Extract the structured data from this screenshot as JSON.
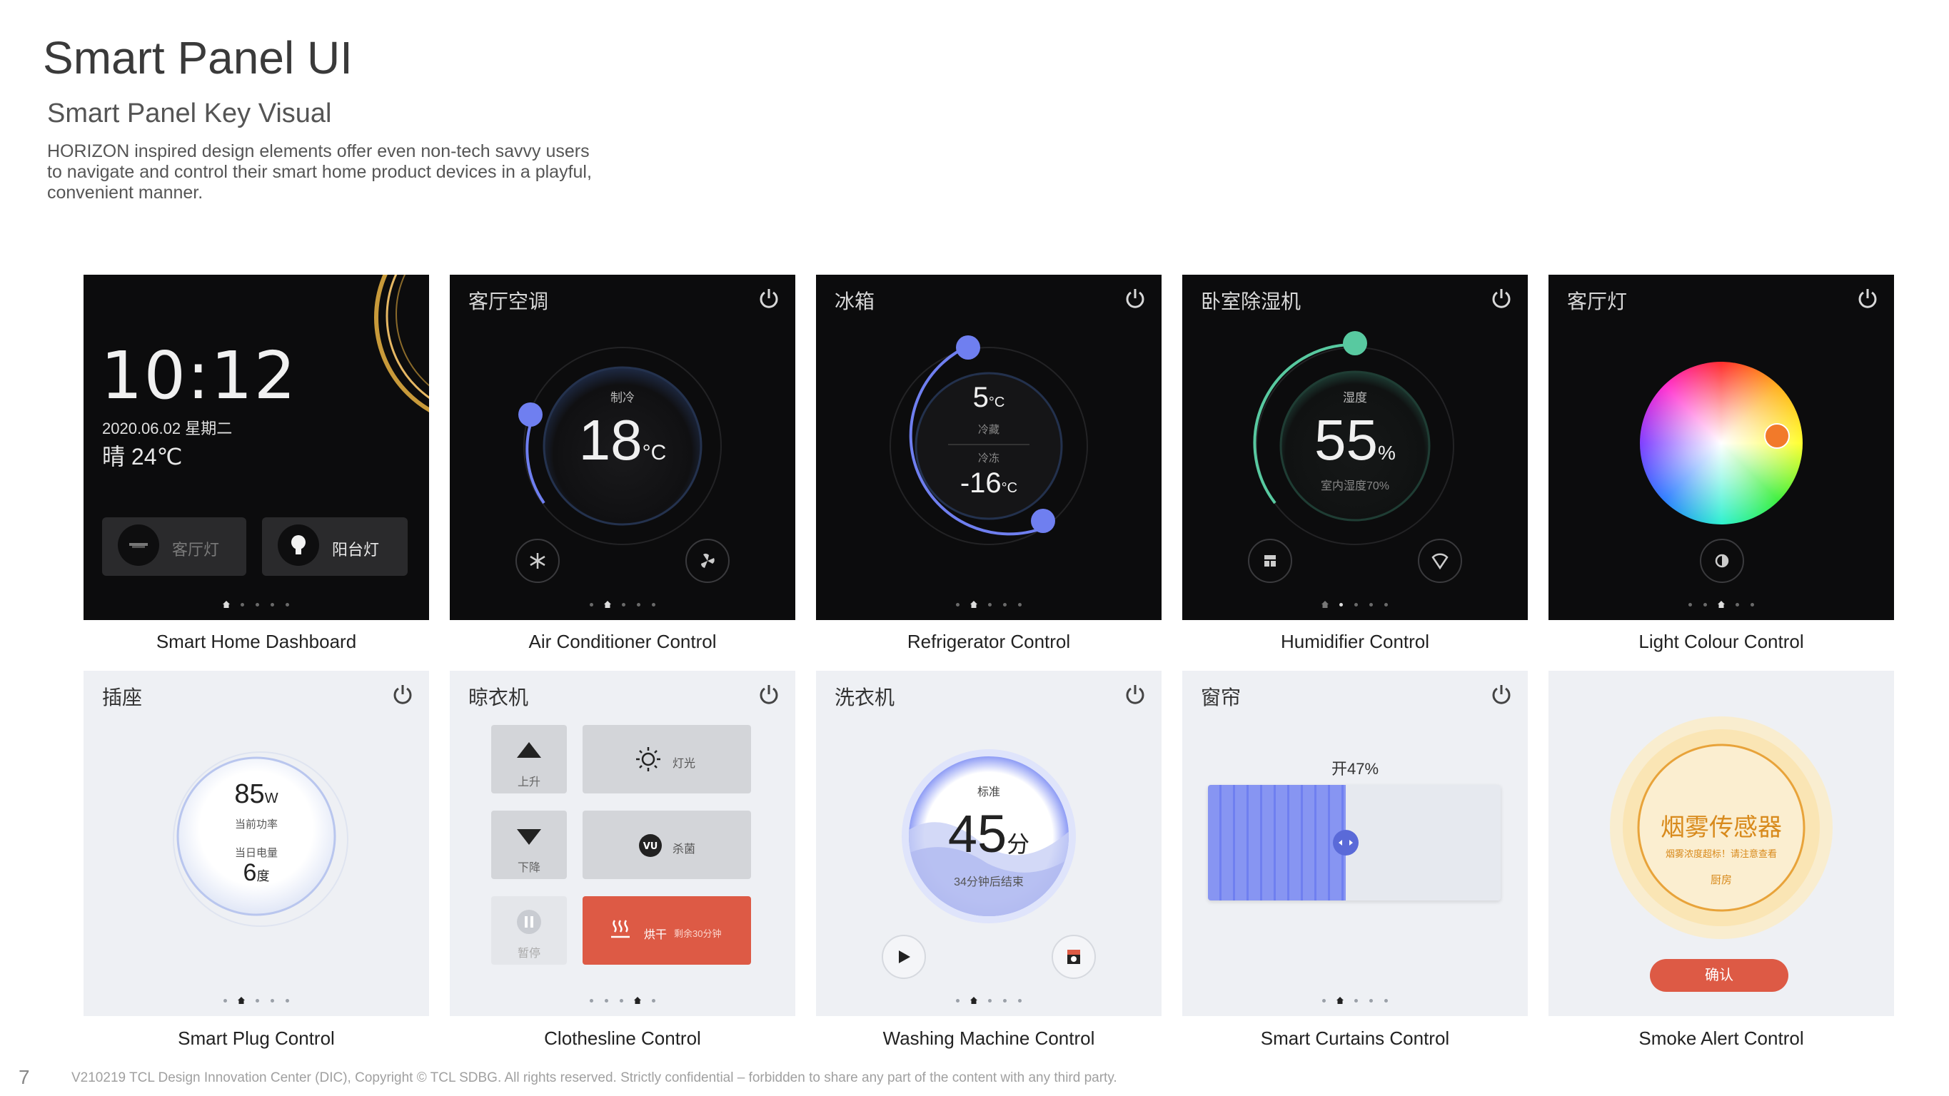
{
  "page": {
    "title": "Smart Panel UI",
    "subtitle": "Smart Panel Key Visual",
    "description": "HORIZON inspired design elements offer even non-tech savvy users to navigate and control their smart home product devices in a playful, convenient manner.",
    "page_number": "7",
    "footer": "V210219 TCL Design Innovation Center (DIC), Copyright © TCL SDBG. All rights reserved. Strictly confidential – forbidden to share any part of the content with any third party."
  },
  "captions": [
    "Smart Home Dashboard",
    "Air Conditioner Control",
    "Refrigerator Control",
    "Humidifier Control",
    "Light Colour Control",
    "Smart Plug Control",
    "Clothesline Control",
    "Washing Machine Control",
    "Smart Curtains Control",
    "Smoke Alert Control"
  ],
  "dashboard": {
    "time": "10:12",
    "date": "2020.06.02 星期二",
    "weather": "晴 24℃",
    "chip1": "客厅灯",
    "chip2": "阳台灯"
  },
  "ac": {
    "title": "客厅空调",
    "mode": "制冷",
    "temp": "18",
    "unit": "°C"
  },
  "fridge": {
    "title": "冰箱",
    "temp1": "5",
    "unit1": "°C",
    "label1": "冷藏",
    "label2": "冷冻",
    "temp2": "-16",
    "unit2": "°C"
  },
  "humidifier": {
    "title": "卧室除湿机",
    "label": "湿度",
    "value": "55",
    "unit": "%",
    "sub": "室内湿度70%"
  },
  "light": {
    "title": "客厅灯"
  },
  "plug": {
    "title": "插座",
    "power": "85",
    "power_unit": "W",
    "power_label": "当前功率",
    "energy_label": "当日电量",
    "energy": "6",
    "energy_unit": "度"
  },
  "clothesline": {
    "title": "晾衣机",
    "up": "上升",
    "down": "下降",
    "pause": "暂停",
    "light": "灯光",
    "sterilize": "杀菌",
    "dry": "烘干",
    "dry_sub": "剩余30分钟"
  },
  "washer": {
    "title": "洗衣机",
    "mode": "标准",
    "time": "45",
    "unit": "分",
    "sub": "34分钟后结束"
  },
  "curtains": {
    "title": "窗帘",
    "status": "开47%",
    "open_percent": 47
  },
  "smoke": {
    "title": "烟雾传感器",
    "warn": "烟雾浓度超标！请注意查看",
    "room": "厨房",
    "confirm": "确认"
  },
  "colors": {
    "accent_blue": "#6f7ff0",
    "accent_green": "#58c9a0",
    "alert_red": "#dd5a45",
    "smoke_orange": "#e8a33a"
  }
}
